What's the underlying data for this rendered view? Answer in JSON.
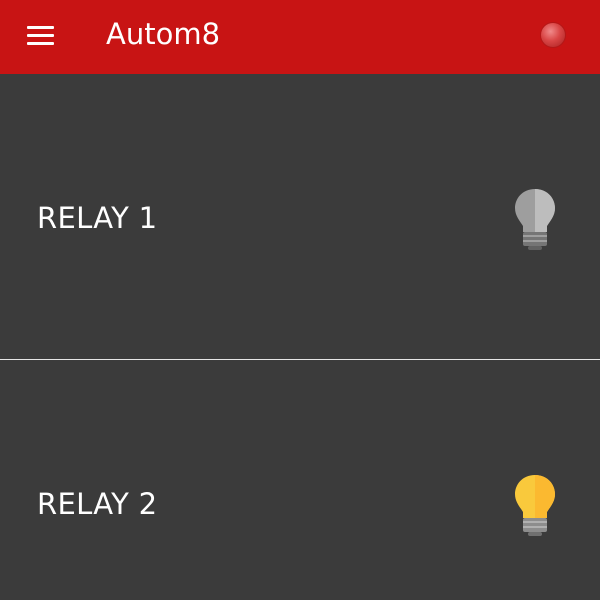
{
  "app": {
    "title": "Autom8"
  },
  "relays": [
    {
      "label": "RELAY 1",
      "state": "off",
      "bulb_icon": "lightbulb-off-icon",
      "bulb_color": "#9e9e9e"
    },
    {
      "label": "RELAY 2",
      "state": "on",
      "bulb_icon": "lightbulb-on-icon",
      "bulb_color": "#fbc02d"
    }
  ],
  "colors": {
    "appbar": "#c81414",
    "background": "#3b3b3b",
    "text": "#ffffff",
    "status_dot": "#d94646"
  }
}
